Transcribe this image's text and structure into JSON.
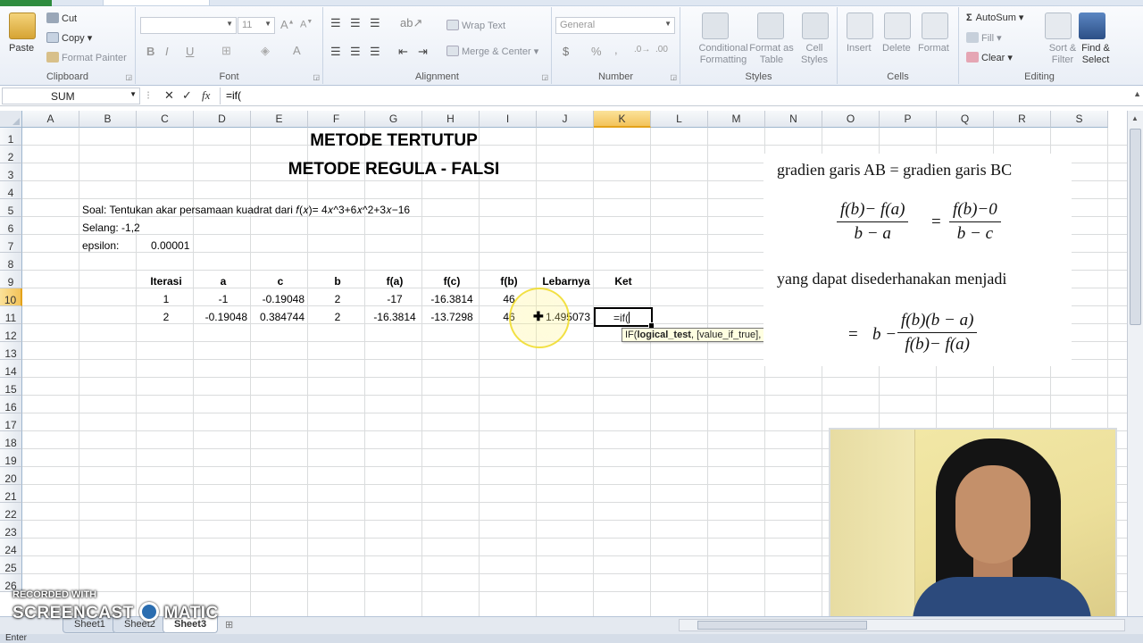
{
  "ribbon": {
    "clipboard": {
      "paste": "Paste",
      "cut": "Cut",
      "copy": "Copy",
      "format_painter": "Format Painter",
      "label": "Clipboard"
    },
    "font": {
      "font_name": "",
      "font_size": "11",
      "bold": "B",
      "italic": "I",
      "underline": "U",
      "label": "Font"
    },
    "alignment": {
      "wrap_text": "Wrap Text",
      "merge_center": "Merge & Center",
      "label": "Alignment"
    },
    "number": {
      "format": "General",
      "currency": "$",
      "percent": "%",
      "comma": ",",
      "label": "Number"
    },
    "styles": {
      "conditional": "Conditional Formatting",
      "format_table": "Format as Table",
      "cell_styles": "Cell Styles",
      "label": "Styles"
    },
    "cells": {
      "insert": "Insert",
      "delete": "Delete",
      "format": "Format",
      "label": "Cells"
    },
    "editing": {
      "autosum": "AutoSum",
      "fill": "Fill",
      "clear": "Clear",
      "sort_filter": "Sort & Filter",
      "find_select": "Find & Select",
      "label": "Editing"
    }
  },
  "formula_bar": {
    "name_box": "SUM",
    "fx": "fx",
    "formula": "=if("
  },
  "columns": [
    "A",
    "B",
    "C",
    "D",
    "E",
    "F",
    "G",
    "H",
    "I",
    "J",
    "K",
    "L",
    "M",
    "N",
    "O",
    "P",
    "Q",
    "R",
    "S"
  ],
  "rows": [
    "1",
    "2",
    "3",
    "4",
    "5",
    "6",
    "7",
    "8",
    "9",
    "10",
    "11",
    "12",
    "13",
    "14",
    "15",
    "16",
    "17",
    "18",
    "19",
    "20",
    "21",
    "22",
    "23",
    "24",
    "25",
    "26"
  ],
  "sheet": {
    "title1": "METODE TERTUTUP",
    "title2": "METODE REGULA - FALSI",
    "soal": "Soal: Tentukan akar persamaan kuadrat dari 𝑓(𝑥)= 4𝑥^3+6𝑥^2+3𝑥−16",
    "selang": "Selang: -1,2",
    "epsilon_label": "epsilon:",
    "epsilon_value": "0.00001",
    "headers": [
      "Iterasi",
      "a",
      "c",
      "b",
      "f(a)",
      "f(c)",
      "f(b)",
      "Lebarnya",
      "Ket"
    ],
    "row9": [
      "1",
      "-1",
      "-0.19048",
      "2",
      "-17",
      "-16.3814",
      "46"
    ],
    "row10": [
      "2",
      "-0.19048",
      "0.384744",
      "2",
      "-16.3814",
      "-13.7298",
      "46",
      "1.495073"
    ],
    "editing_value": "=if("
  },
  "tooltip": {
    "prefix": "IF(",
    "bold": "logical_test",
    "rest": ", [value_if_true], [value_if_false])"
  },
  "formula_image": {
    "line1": "gradien garis AB =  gradien garis BC",
    "line2": "yang dapat disederhanakan menjadi",
    "frac1_num": "f(b)− f(a)",
    "frac1_den": "b − a",
    "frac2_num": "f(b)−0",
    "frac2_den": "b − c",
    "c_eq": "=",
    "b_minus": "b −",
    "frac3_num": "f(b)(b − a)",
    "frac3_den": "f(b)− f(a)"
  },
  "sheet_tabs": [
    "Sheet1",
    "Sheet2",
    "Sheet3"
  ],
  "status": "Enter",
  "watermark": {
    "small": "RECORDED WITH",
    "big_left": "SCREENCAST",
    "big_right": "MATIC"
  }
}
